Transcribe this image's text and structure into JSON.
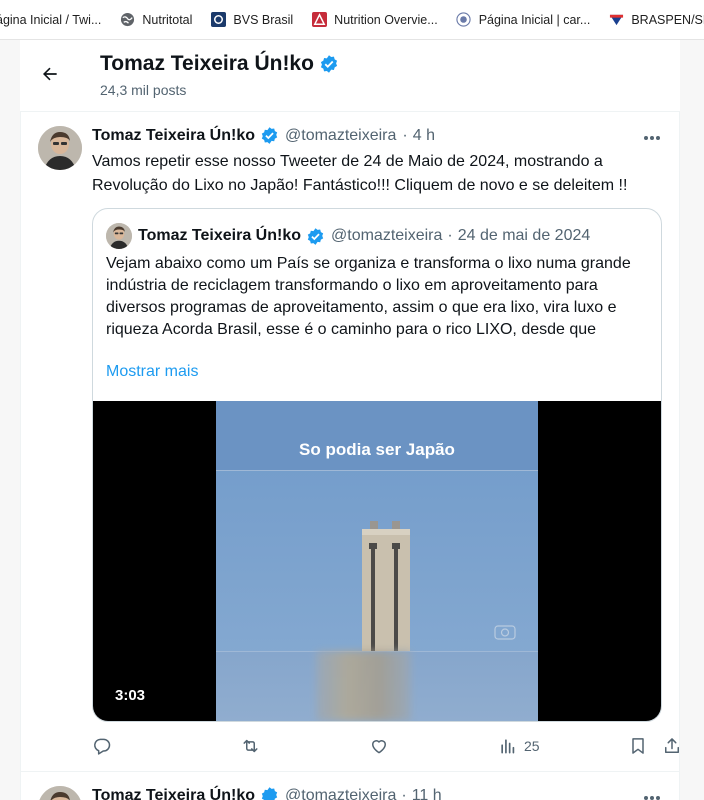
{
  "bookmarks": [
    {
      "label": "ágina Inicial / Twi...",
      "icon": "x-twitter-icon"
    },
    {
      "label": "Nutritotal",
      "icon": "globe-icon"
    },
    {
      "label": "BVS Brasil",
      "icon": "bvs-icon"
    },
    {
      "label": "Nutrition Overvie...",
      "icon": "nutrition-icon"
    },
    {
      "label": "Página Inicial | car...",
      "icon": "seal-icon"
    },
    {
      "label": "BRASPEN/SE",
      "icon": "braspen-icon"
    }
  ],
  "header": {
    "name": "Tomaz Teixeira Ún!ko",
    "posts": "24,3 mil posts"
  },
  "tweet": {
    "name": "Tomaz Teixeira Ún!ko",
    "handle": "@tomazteixeira",
    "sep": "·",
    "time": "4 h",
    "text": "Vamos repetir esse nosso Tweeter de 24 de Maio de 2024, mostrando a Revolução do Lixo no Japão! Fantástico!!! Cliquem de novo e se deleitem !!",
    "quote": {
      "name": "Tomaz Teixeira Ún!ko",
      "handle": "@tomazteixeira",
      "sep": "·",
      "date": "24 de mai de 2024",
      "text": "Vejam abaixo como um País se organiza e transforma o lixo numa grande indústria de reciclagem transformando o lixo em aproveitamento para diversos programas de aproveitamento, assim o que era lixo, vira luxo e riqueza Acorda Brasil, esse é o caminho para o rico LIXO, desde que",
      "show_more": "Mostrar mais",
      "video": {
        "caption": "So podia ser Japão",
        "duration": "3:03"
      }
    },
    "actions": {
      "views": "25"
    }
  },
  "next_tweet": {
    "name": "Tomaz Teixeira Ún!ko",
    "handle": "@tomazteixeira",
    "sep": "·",
    "time": "11 h"
  },
  "colors": {
    "accent": "#1d9bf0",
    "text": "#0f1419",
    "muted": "#536471",
    "border": "#cfd9de"
  }
}
